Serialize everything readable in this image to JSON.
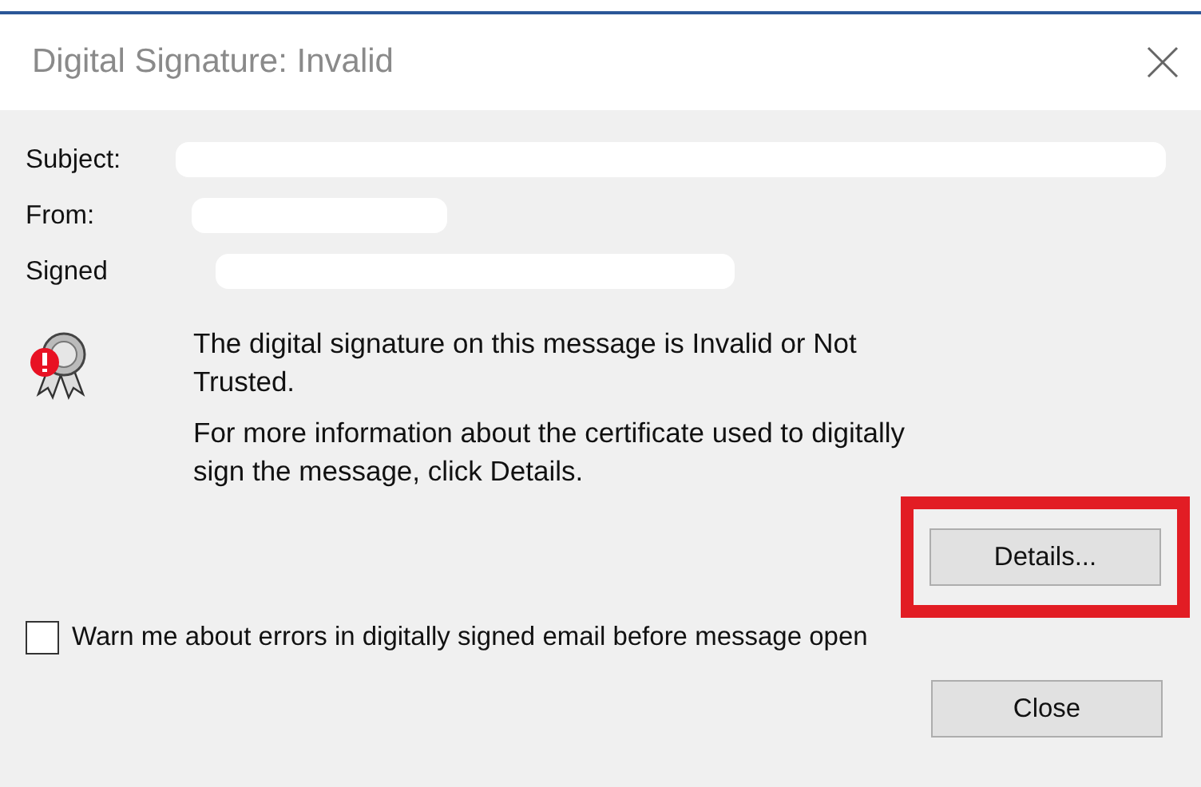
{
  "window": {
    "title": "Digital Signature: Invalid"
  },
  "fields": [
    {
      "label": "Subject:"
    },
    {
      "label": "From:"
    },
    {
      "label": "Signed"
    }
  ],
  "message": [
    "The digital signature on this message is Invalid or Not Trusted.",
    "For more information about the certificate used to digitally sign the message, click Details."
  ],
  "details_button": "Details...",
  "warn_checkbox": {
    "label": "Warn me about errors in digitally signed email before message open",
    "checked": false
  },
  "close_button": "Close"
}
